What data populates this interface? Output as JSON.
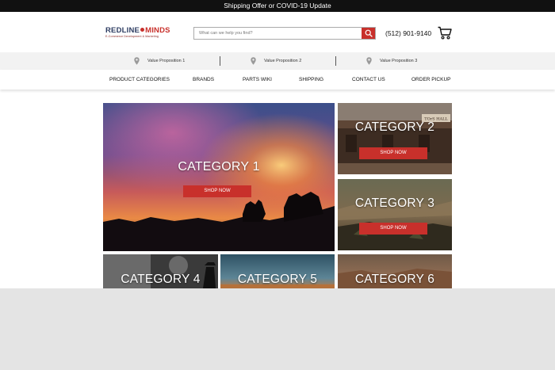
{
  "topbar": {
    "text": "Shipping Offer or COVID-19 Update"
  },
  "header": {
    "logo_left": "REDLINE",
    "logo_right": "MINDS",
    "logo_tagline": "E-Commerce Development & Marketing",
    "search_placeholder": "What can we help you find?",
    "phone": "(512) 901-9140"
  },
  "value_props": [
    {
      "label": "Value Proposition 1",
      "icon": "map-pin-icon"
    },
    {
      "label": "Value Proposition 2",
      "icon": "map-pin-icon"
    },
    {
      "label": "Value Proposition 3",
      "icon": "map-pin-icon"
    }
  ],
  "nav": [
    "PRODUCT CATEGORIES",
    "BRANDS",
    "PARTS WIKI",
    "SHIPPING",
    "CONTACT US",
    "ORDER PICKUP"
  ],
  "categories": [
    {
      "label": "CATEGORY 1",
      "button": "SHOP NOW"
    },
    {
      "label": "CATEGORY 2",
      "button": "SHOP NOW",
      "sign": "TOrS HALL"
    },
    {
      "label": "CATEGORY 3",
      "button": "SHOP NOW"
    },
    {
      "label": "CATEGORY 4"
    },
    {
      "label": "CATEGORY 5"
    },
    {
      "label": "CATEGORY 6"
    }
  ],
  "colors": {
    "accent": "#c8302b",
    "topbar": "#111111",
    "value_bar": "#f2f2f2",
    "logo_navy": "#2f3e63",
    "outside": "#e4e4e4"
  }
}
